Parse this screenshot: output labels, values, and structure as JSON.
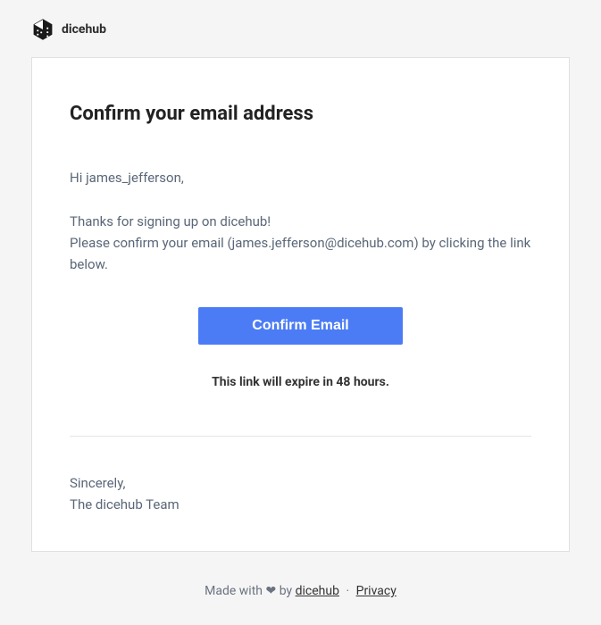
{
  "brand": {
    "name": "dicehub"
  },
  "email": {
    "title": "Confirm your email address",
    "greeting": "Hi james_jefferson,",
    "thanks_line": "Thanks for signing up on dicehub!",
    "confirm_line": "Please confirm your email (james.jefferson@dicehub.com) by clicking the link below.",
    "button_label": "Confirm Email",
    "expire_notice": "This link will expire in 48 hours.",
    "signoff_label": "Sincerely,",
    "signoff_team": "The dicehub Team"
  },
  "footer": {
    "made_with": "Made with",
    "heart": "❤",
    "by": "by",
    "brand_link": "dicehub",
    "separator": "·",
    "privacy_link": "Privacy"
  }
}
